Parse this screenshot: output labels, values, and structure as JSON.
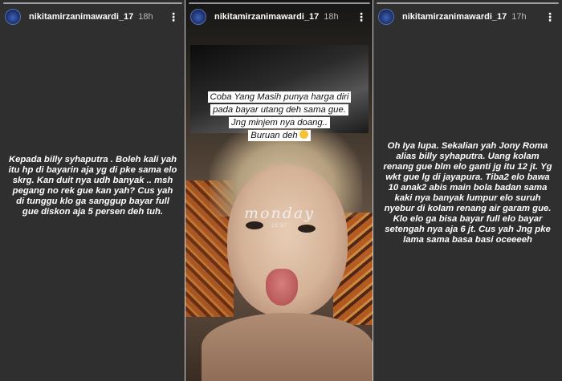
{
  "stories": [
    {
      "username": "nikitamirzanimawardi_17",
      "time": "18h",
      "text": "Kepada billy syhaputra . Boleh kali yah itu hp di bayarin aja yg di pke sama elo skrg. Kan duit nya udh banyak .. msh pegang no rek gue kan yah? Cus yah di tunggu klo ga sanggup bayar full gue diskon aja 5 persen deh tuh."
    },
    {
      "username": "nikitamirzanimawardi_17",
      "time": "18h",
      "caption_lines": [
        "Coba Yang Masih punya harga diri",
        "pada bayar utang deh sama gue.",
        "Jng minjem nya doang..",
        "Buruan deh"
      ],
      "sticker_text": "monday",
      "sticker_time": "15:57"
    },
    {
      "username": "nikitamirzanimawardi_17",
      "time": "17h",
      "text": "Oh Iya lupa. Sekalian yah Jony Roma alias billy syhaputra. Uang kolam renang gue blm elo ganti jg itu 12 jt. Yg wkt gue lg di jayapura. Tiba2 elo bawa 10 anak2 abis main bola badan sama kaki nya banyak lumpur elo suruh nyebur di kolam renang air garam gue. Klo elo ga bisa bayar full elo bayar setengah nya aja 6 jt. Cus yah Jng pke lama sama basa basi oceeeeh"
    }
  ],
  "more_icon": "more-options-icon",
  "colors": {
    "panel_bg": "#2f2f2f",
    "divider": "#d8d8d8",
    "text": "#ffffff",
    "time": "#b9b9b9"
  }
}
